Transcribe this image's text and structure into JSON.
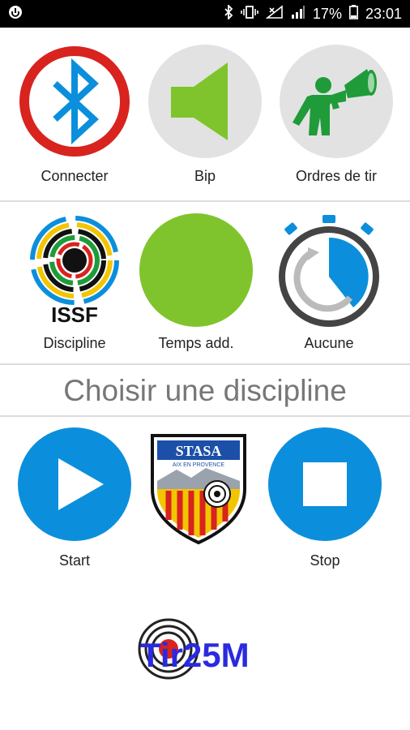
{
  "status_bar": {
    "battery_percent": "17%",
    "time": "23:01",
    "icons": [
      "app-notification-icon",
      "bluetooth-icon",
      "vibrate-icon",
      "signal-x-icon",
      "signal-bars-icon",
      "battery-icon"
    ]
  },
  "row1": {
    "connect_label": "Connecter",
    "bip_label": "Bip",
    "orders_label": "Ordres de tir"
  },
  "row2": {
    "issf_text": "ISSF",
    "discipline_label": "Discipline",
    "extra_time_label": "Temps add.",
    "timer_label": "Aucune"
  },
  "discipline_prompt": "Choisir une discipline",
  "row3": {
    "start_label": "Start",
    "stop_label": "Stop",
    "club_logo_text": "STASA",
    "club_logo_subtext": "AIX EN PROVENCE"
  },
  "app_logo_text": "Tir25M",
  "colors": {
    "blue": "#0b8fdc",
    "green": "#7fc42c",
    "red": "#d8231f",
    "grey_circle": "#e2e2e2",
    "dark_blue_text": "#2a2ae0"
  }
}
